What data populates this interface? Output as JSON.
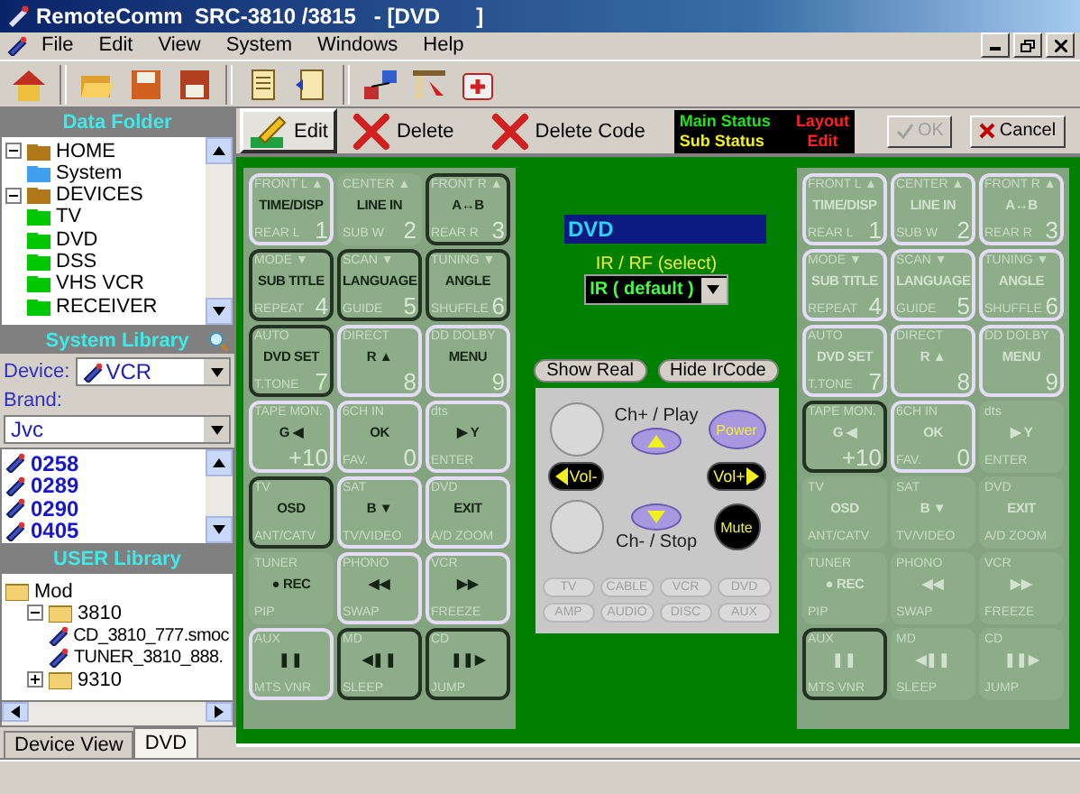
{
  "window": {
    "title": "RemoteComm  SRC-3810 /3815   - [DVD      ]"
  },
  "menu": [
    "File",
    "Edit",
    "View",
    "System",
    "Windows",
    "Help"
  ],
  "data_folder": {
    "title": "Data Folder",
    "tree": [
      {
        "label": "HOME",
        "color": "#b07818",
        "expanded": true,
        "children": [
          {
            "label": "System",
            "color": "#40a0f0"
          }
        ]
      },
      {
        "label": "DEVICES",
        "color": "#b07818",
        "expanded": true,
        "children": [
          {
            "label": "TV",
            "color": "#00c800"
          },
          {
            "label": "DVD",
            "color": "#00c800"
          },
          {
            "label": "DSS",
            "color": "#00c800"
          },
          {
            "label": "VHS VCR",
            "color": "#00c800"
          },
          {
            "label": "RECEIVER",
            "color": "#00c800"
          }
        ]
      }
    ]
  },
  "system_library": {
    "title": "System Library",
    "device_label": "Device:",
    "device": "VCR",
    "brand_label": "Brand:",
    "brand": "Jvc",
    "codes": [
      "0258",
      "0289",
      "0290",
      "0405"
    ]
  },
  "user_library": {
    "title": "USER Library",
    "tree": [
      {
        "label": "Mod",
        "kind": "folder",
        "children": [
          {
            "label": "3810",
            "kind": "folder",
            "expanded": true,
            "children": [
              {
                "label": "CD_3810_777.smoc",
                "kind": "file"
              },
              {
                "label": "TUNER_3810_888.",
                "kind": "file"
              }
            ]
          },
          {
            "label": "9310",
            "kind": "folder",
            "expanded": false
          }
        ]
      }
    ]
  },
  "edit_toolbar": {
    "buttons": [
      {
        "label": "Edit",
        "kind": "edit",
        "selected": true
      },
      {
        "label": "Delete",
        "kind": "delete",
        "selected": false
      },
      {
        "label": "Delete Code",
        "kind": "delete",
        "selected": false
      }
    ],
    "status": {
      "main": "Main Status",
      "layout": "Layout",
      "sub": "Sub Status",
      "mode": "Edit"
    },
    "ok": {
      "label": "OK",
      "disabled": true
    },
    "cancel": {
      "label": "Cancel"
    }
  },
  "remotes": [
    {
      "keys": [
        {
          "top": "FRONT L ▲",
          "mid": "TIME/DISP",
          "bottom": "REAR L",
          "num": "1",
          "outlined": true,
          "pressed": false
        },
        {
          "top": "CENTER ▲",
          "mid": "LINE IN",
          "bottom": "SUB W",
          "num": "2",
          "outlined": false,
          "pressed": false
        },
        {
          "top": "FRONT R ▲",
          "mid": "A↔B",
          "bottom": "REAR R",
          "num": "3",
          "outlined": true,
          "pressed": true
        },
        {
          "top": "MODE ▼",
          "mid": "SUB TITLE",
          "bottom": "REPEAT",
          "num": "4",
          "outlined": true,
          "pressed": true
        },
        {
          "top": "SCAN ▼",
          "mid": "LANGUAGE",
          "bottom": "GUIDE",
          "num": "5",
          "outlined": true,
          "pressed": true
        },
        {
          "top": "TUNING ▼",
          "mid": "ANGLE",
          "bottom": "SHUFFLE",
          "num": "6",
          "outlined": true,
          "pressed": true
        },
        {
          "top": "AUTO",
          "mid": "DVD SET",
          "bottom": "T.TONE",
          "num": "7",
          "outlined": true,
          "pressed": true
        },
        {
          "top": "DIRECT",
          "mid": "R ▲",
          "num": "8",
          "outlined": true,
          "pressed": false
        },
        {
          "top": "DD DOLBY",
          "mid": "MENU",
          "num": "9",
          "outlined": true,
          "pressed": false
        },
        {
          "top": "TAPE MON.",
          "mid": "G ◀",
          "num": "+10",
          "outlined": true,
          "pressed": false
        },
        {
          "top": "6CH IN",
          "mid": "OK",
          "bottom": "FAV.",
          "num": "0",
          "outlined": true,
          "pressed": false
        },
        {
          "top": "dts",
          "mid": "▶ Y",
          "bottom": "ENTER",
          "outlined": true,
          "pressed": false
        },
        {
          "top": "TV",
          "mid": "OSD",
          "bottom": "ANT/CATV",
          "outlined": true,
          "pressed": true
        },
        {
          "top": "SAT",
          "mid": "B ▼",
          "bottom": "TV/VIDEO",
          "outlined": true,
          "pressed": false
        },
        {
          "top": "DVD",
          "mid": "EXIT",
          "bottom": "A/D ZOOM",
          "outlined": true,
          "pressed": false
        },
        {
          "top": "TUNER",
          "mid": "● REC",
          "bottom": "PIP",
          "outlined": false,
          "pressed": false
        },
        {
          "top": "PHONO",
          "mid": "◀◀",
          "bottom": "SWAP",
          "outlined": true,
          "pressed": false
        },
        {
          "top": "VCR",
          "mid": "▶▶",
          "bottom": "FREEZE",
          "outlined": true,
          "pressed": false
        },
        {
          "top": "AUX",
          "mid": "❚❚",
          "bottom": "MTS VNR",
          "outlined": true,
          "pressed": false
        },
        {
          "top": "MD",
          "mid": "◀❚❚",
          "bottom": "SLEEP",
          "outlined": true,
          "pressed": true
        },
        {
          "top": "CD",
          "mid": "❚❚▶",
          "bottom": "JUMP",
          "outlined": true,
          "pressed": true
        }
      ]
    },
    {
      "keys": [
        {
          "top": "FRONT L ▲",
          "mid": "TIME/DISP",
          "bottom": "REAR L",
          "num": "1",
          "outlined": true,
          "pressed": false
        },
        {
          "top": "CENTER ▲",
          "mid": "LINE IN",
          "bottom": "SUB W",
          "num": "2",
          "outlined": true,
          "pressed": false
        },
        {
          "top": "FRONT R ▲",
          "mid": "A↔B",
          "bottom": "REAR R",
          "num": "3",
          "outlined": true,
          "pressed": false
        },
        {
          "top": "MODE ▼",
          "mid": "SUB TITLE",
          "bottom": "REPEAT",
          "num": "4",
          "outlined": true,
          "pressed": false
        },
        {
          "top": "SCAN ▼",
          "mid": "LANGUAGE",
          "bottom": "GUIDE",
          "num": "5",
          "outlined": true,
          "pressed": false
        },
        {
          "top": "TUNING ▼",
          "mid": "ANGLE",
          "bottom": "SHUFFLE",
          "num": "6",
          "outlined": true,
          "pressed": false
        },
        {
          "top": "AUTO",
          "mid": "DVD SET",
          "bottom": "T.TONE",
          "num": "7",
          "outlined": true,
          "pressed": false
        },
        {
          "top": "DIRECT",
          "mid": "R ▲",
          "num": "8",
          "outlined": true,
          "pressed": false
        },
        {
          "top": "DD DOLBY",
          "mid": "MENU",
          "num": "9",
          "outlined": true,
          "pressed": false
        },
        {
          "top": "TAPE MON.",
          "mid": "G ◀",
          "num": "+10",
          "outlined": true,
          "pressed": true
        },
        {
          "top": "6CH IN",
          "mid": "OK",
          "bottom": "FAV.",
          "num": "0",
          "outlined": true,
          "pressed": false
        },
        {
          "top": "dts",
          "mid": "▶ Y",
          "bottom": "ENTER",
          "outlined": false,
          "pressed": false
        },
        {
          "top": "TV",
          "mid": "OSD",
          "bottom": "ANT/CATV",
          "outlined": false,
          "pressed": false
        },
        {
          "top": "SAT",
          "mid": "B ▼",
          "bottom": "TV/VIDEO",
          "outlined": false,
          "pressed": false
        },
        {
          "top": "DVD",
          "mid": "EXIT",
          "bottom": "A/D ZOOM",
          "outlined": false,
          "pressed": false
        },
        {
          "top": "TUNER",
          "mid": "● REC",
          "bottom": "PIP",
          "outlined": false,
          "pressed": false
        },
        {
          "top": "PHONO",
          "mid": "◀◀",
          "bottom": "SWAP",
          "outlined": false,
          "pressed": false
        },
        {
          "top": "VCR",
          "mid": "▶▶",
          "bottom": "FREEZE",
          "outlined": false,
          "pressed": false
        },
        {
          "top": "AUX",
          "mid": "❚❚",
          "bottom": "MTS VNR",
          "outlined": true,
          "pressed": true
        },
        {
          "top": "MD",
          "mid": "◀❚❚",
          "bottom": "SLEEP",
          "outlined": false,
          "pressed": false
        },
        {
          "top": "CD",
          "mid": "❚❚▶",
          "bottom": "JUMP",
          "outlined": false,
          "pressed": false
        }
      ]
    }
  ],
  "device_panel": {
    "name": "DVD",
    "ir_label": "IR / RF (select)",
    "ir_value": "IR ( default )",
    "show_real": "Show Real",
    "hide_ircode": "Hide IrCode",
    "ch_up_label": "Ch+ / Play",
    "power": "Power",
    "vol_down": "Vol-",
    "vol_up": "Vol+",
    "ch_down_label": "Ch- / Stop",
    "mute": "Mute",
    "sources": [
      "TV",
      "CABLE",
      "VCR",
      "DVD",
      "AMP",
      "AUDIO",
      "DISC",
      "AUX"
    ]
  },
  "tabs": [
    {
      "label": "Device View",
      "selected": false
    },
    {
      "label": "DVD",
      "selected": true
    }
  ]
}
